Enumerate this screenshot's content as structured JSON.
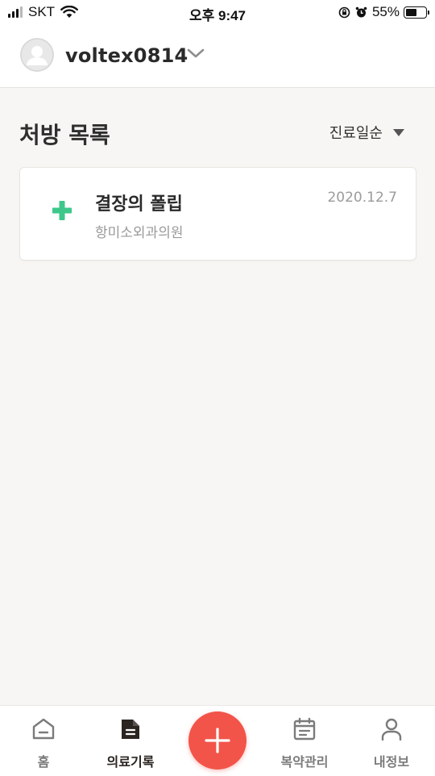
{
  "status_bar": {
    "carrier": "SKT",
    "time": "오후 9:47",
    "battery_percent": "55%",
    "battery_level": 0.55
  },
  "header": {
    "username": "voltex0814"
  },
  "prescriptions": {
    "title": "처방 목록",
    "sort_label": "진료일순",
    "items": [
      {
        "diagnosis": "결장의 폴립",
        "hospital": "항미소외과의원",
        "date": "2020.12.7",
        "icon": "green-cross-icon"
      }
    ]
  },
  "tab_bar": {
    "tabs": [
      {
        "label": "홈",
        "icon": "home-icon",
        "active": false
      },
      {
        "label": "의료기록",
        "icon": "medical-record-icon",
        "active": true
      },
      {
        "label": "복약관리",
        "icon": "calendar-icon",
        "active": false
      },
      {
        "label": "내정보",
        "icon": "person-icon",
        "active": false
      }
    ],
    "fab_icon": "plus-icon"
  },
  "colors": {
    "accent_red": "#f25449",
    "cross_green": "#3ec78a",
    "background": "#f8f6f4"
  }
}
